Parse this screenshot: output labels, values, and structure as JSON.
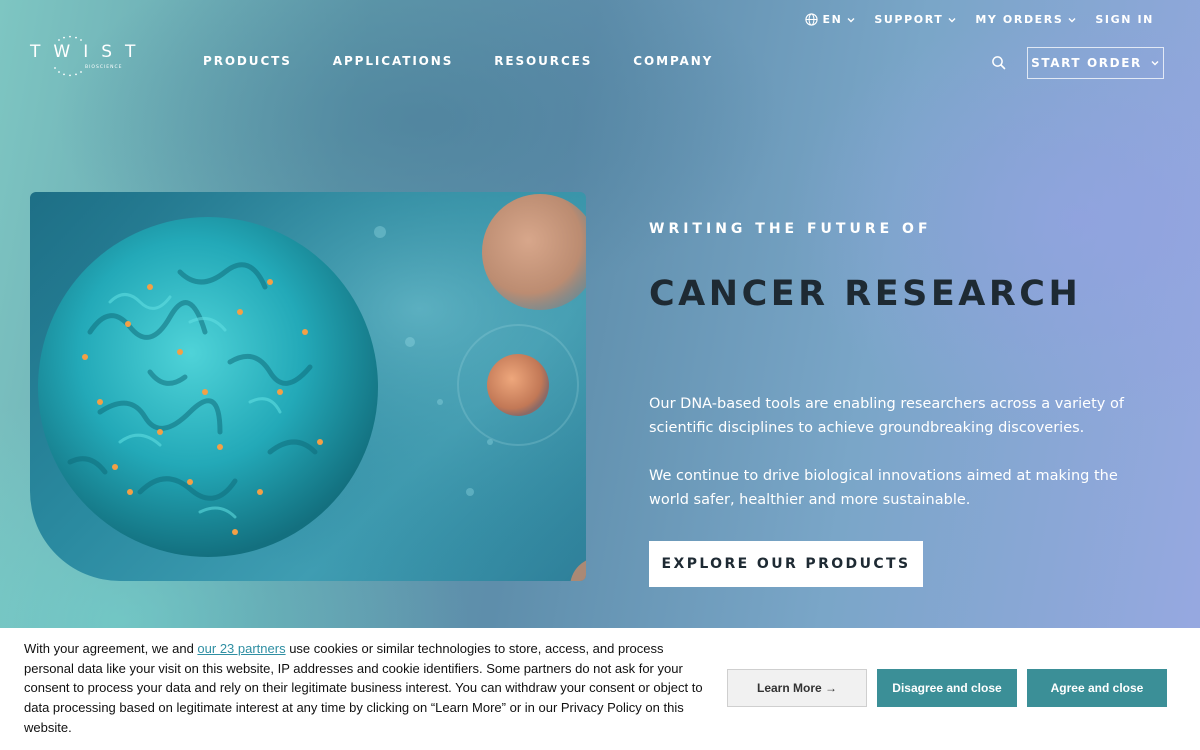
{
  "utility": {
    "language": "EN",
    "support": "SUPPORT",
    "my_orders": "MY ORDERS",
    "sign_in": "SIGN IN"
  },
  "logo": {
    "word": "TWIST",
    "sub": "BIOSCIENCE"
  },
  "nav": {
    "items": [
      "PRODUCTS",
      "APPLICATIONS",
      "RESOURCES",
      "COMPANY"
    ],
    "start_order": "START ORDER"
  },
  "hero": {
    "eyebrow": "WRITING THE FUTURE OF",
    "headline": "CANCER RESEARCH",
    "paragraph_1": "Our DNA-based tools are enabling researchers across a variety of scientific disciplines to achieve groundbreaking discoveries.",
    "paragraph_2": "We continue to drive biological innovations aimed at making the world safer, healthier and more sustainable.",
    "cta": "EXPLORE OUR PRODUCTS"
  },
  "cookie": {
    "text_before_link": "With your agreement, we and ",
    "link_text": "our 23 partners",
    "text_after_link": " use cookies or similar technologies to store, access, and process personal data like your visit on this website, IP addresses and cookie identifiers. Some partners do not ask for your consent to process your data and rely on their legitimate business interest. You can withdraw your consent or object to data processing based on legitimate interest at any time by clicking on “Learn More” or in our Privacy Policy on this website.",
    "learn_more": "Learn More →",
    "disagree": "Disagree and close",
    "agree": "Agree and close"
  },
  "colors": {
    "accent": "#3b8f97",
    "headline": "#1e2a33",
    "link": "#2f8fa3"
  }
}
